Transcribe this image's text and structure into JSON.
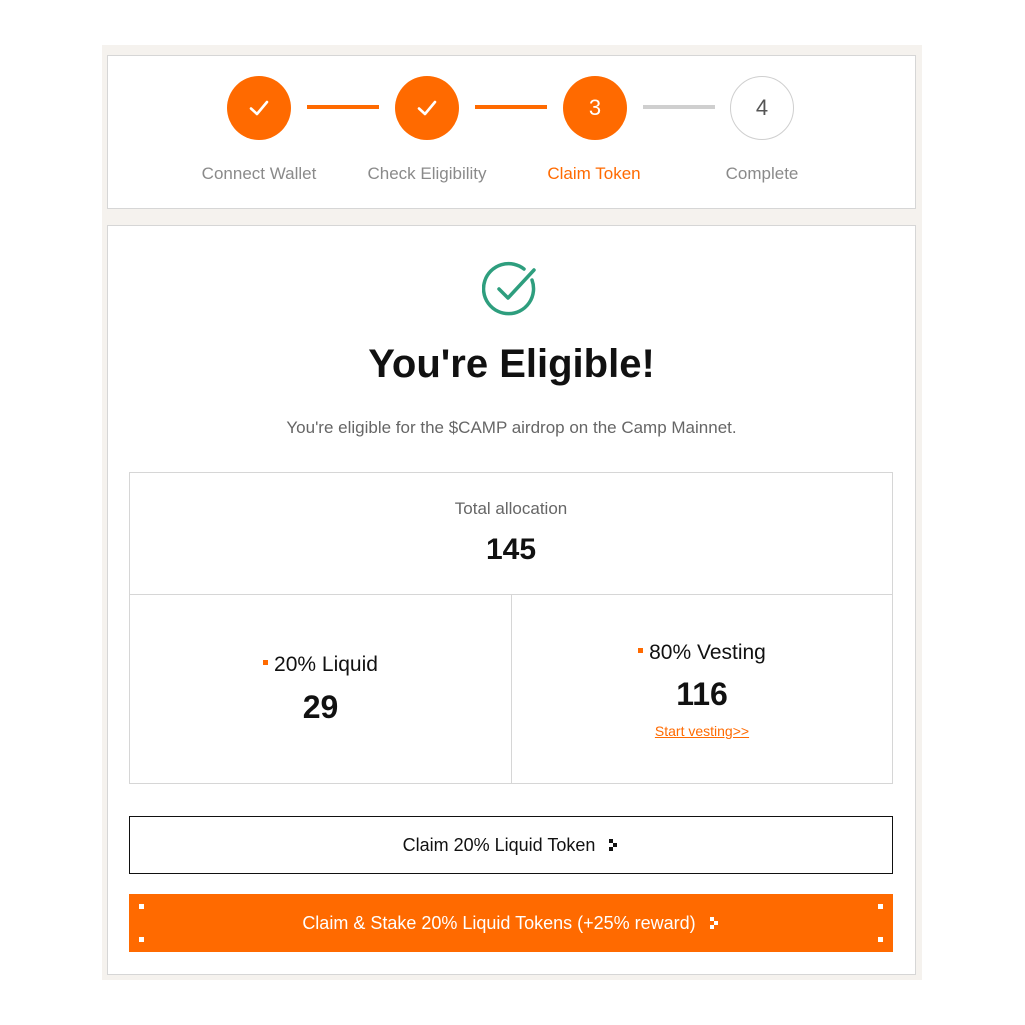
{
  "steps": [
    {
      "label": "Connect Wallet",
      "state": "done",
      "marker": "✓"
    },
    {
      "label": "Check Eligibility",
      "state": "done",
      "marker": "✓"
    },
    {
      "label": "Claim Token",
      "state": "active",
      "marker": "3"
    },
    {
      "label": "Complete",
      "state": "todo",
      "marker": "4"
    }
  ],
  "result": {
    "icon": "check-circle-icon",
    "title": "You're Eligible!",
    "subtitle": "You're eligible for the $CAMP airdrop on the Camp Mainnet."
  },
  "allocation": {
    "total_label": "Total allocation",
    "total_value": "145",
    "liquid_label": "20% Liquid",
    "liquid_value": "29",
    "vesting_label": "80% Vesting",
    "vesting_value": "116",
    "vesting_link": "Start vesting>>"
  },
  "buttons": {
    "claim_liquid": "Claim 20% Liquid Token",
    "claim_stake": "Claim & Stake 20% Liquid Tokens (+25% reward)"
  },
  "colors": {
    "accent": "#ff6a00",
    "success": "#2e9e7e",
    "inactive": "#cfcfcf"
  }
}
